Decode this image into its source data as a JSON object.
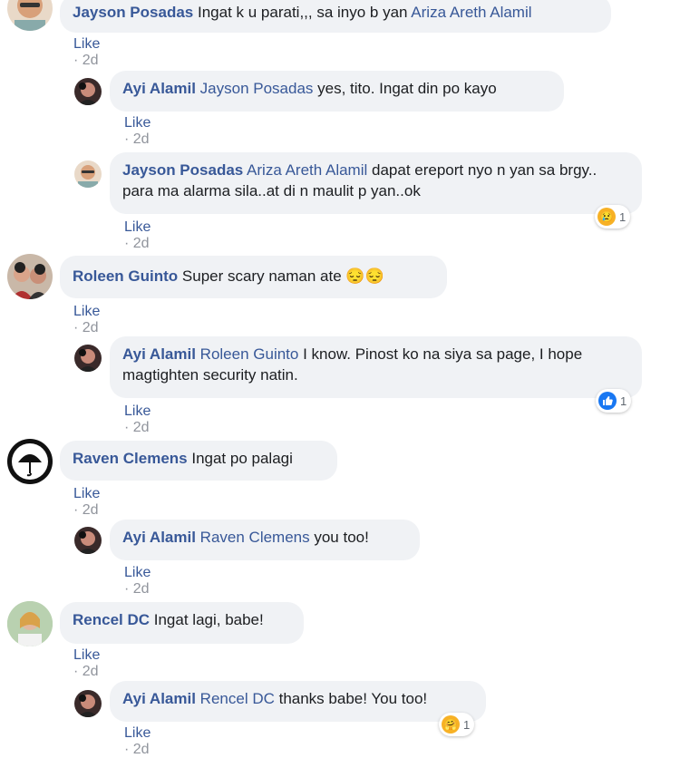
{
  "comments": [
    {
      "author": "Jayson Posadas",
      "mention": "",
      "text": "Ingat k u parati,,, sa inyo b yan ",
      "mention_after": "Ariza Areth Alamil",
      "like": "Like",
      "time": "2d"
    },
    {
      "author": "Ayi Alamil",
      "mention": "Jayson Posadas",
      "text": " yes, tito. Ingat din po kayo",
      "like": "Like",
      "time": "2d"
    },
    {
      "author": "Jayson Posadas",
      "mention": "Ariza Areth Alamil",
      "text": " dapat ereport nyo n yan sa brgy.. para ma alarma sila..at di n maulit p yan..ok",
      "like": "Like",
      "time": "2d",
      "reaction": {
        "icon": "sad-reaction-icon",
        "count": "1"
      }
    },
    {
      "author": "Roleen Guinto",
      "mention": "",
      "text": " Super scary naman ate 😔😔",
      "like": "Like",
      "time": "2d"
    },
    {
      "author": "Ayi Alamil",
      "mention": "Roleen Guinto",
      "text": " I know. Pinost ko na siya sa page, I hope magtighten security natin.",
      "like": "Like",
      "time": "2d",
      "reaction": {
        "icon": "like-reaction-icon",
        "count": "1"
      }
    },
    {
      "author": "Raven Clemens",
      "mention": "",
      "text": " Ingat po palagi",
      "like": "Like",
      "time": "2d"
    },
    {
      "author": "Ayi Alamil",
      "mention": "Raven Clemens",
      "text": " you too!",
      "like": "Like",
      "time": "2d"
    },
    {
      "author": "Rencel DC",
      "mention": "",
      "text": " Ingat lagi, babe!",
      "like": "Like",
      "time": "2d"
    },
    {
      "author": "Ayi Alamil",
      "mention": "Rencel DC",
      "text": " thanks babe! You too!",
      "like": "Like",
      "time": "2d",
      "reaction": {
        "icon": "care-reaction-icon",
        "count": "1"
      }
    }
  ],
  "separator": " · ",
  "colors": {
    "link": "#385898",
    "bubble": "#f0f2f5",
    "meta": "#90949c",
    "like_blue": "#1877f2"
  }
}
